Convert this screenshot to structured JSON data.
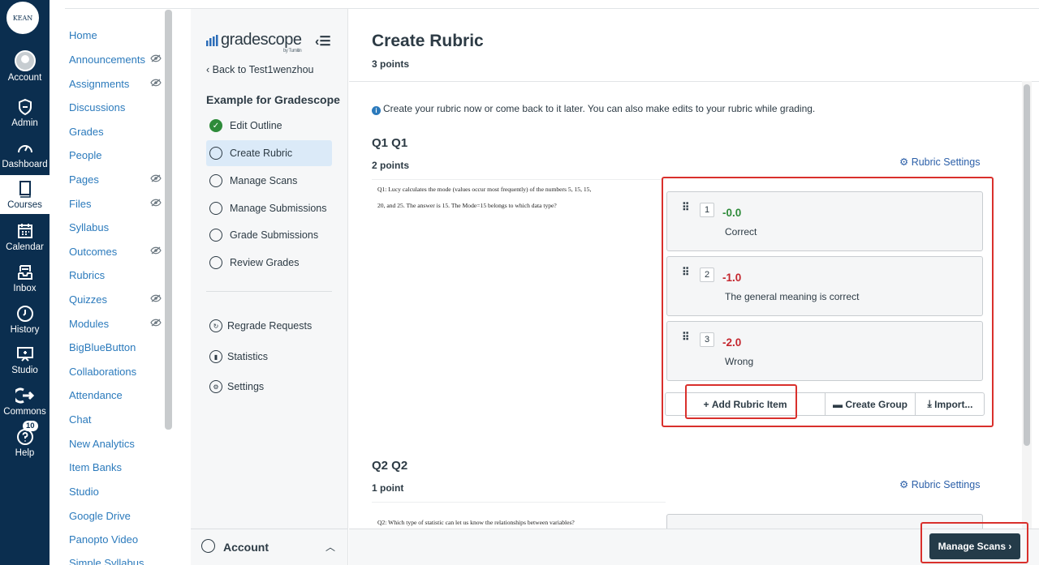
{
  "global_nav": {
    "items": [
      {
        "label": "Account",
        "icon": "account-avatar-icon"
      },
      {
        "label": "Admin",
        "icon": "shield-icon"
      },
      {
        "label": "Dashboard",
        "icon": "dashboard-gauge-icon"
      },
      {
        "label": "Courses",
        "icon": "book-icon"
      },
      {
        "label": "Calendar",
        "icon": "calendar-icon"
      },
      {
        "label": "Inbox",
        "icon": "inbox-icon"
      },
      {
        "label": "History",
        "icon": "clock-icon"
      },
      {
        "label": "Studio",
        "icon": "studio-icon"
      },
      {
        "label": "Commons",
        "icon": "commons-arrow-icon"
      },
      {
        "label": "Help",
        "icon": "help-icon",
        "badge": "10"
      }
    ]
  },
  "course_nav": {
    "links": [
      {
        "label": "Home",
        "hidden": false
      },
      {
        "label": "Announcements",
        "hidden": true
      },
      {
        "label": "Assignments",
        "hidden": true
      },
      {
        "label": "Discussions",
        "hidden": false
      },
      {
        "label": "Grades",
        "hidden": false
      },
      {
        "label": "People",
        "hidden": false
      },
      {
        "label": "Pages",
        "hidden": true
      },
      {
        "label": "Files",
        "hidden": true
      },
      {
        "label": "Syllabus",
        "hidden": false
      },
      {
        "label": "Outcomes",
        "hidden": true
      },
      {
        "label": "Rubrics",
        "hidden": false
      },
      {
        "label": "Quizzes",
        "hidden": true
      },
      {
        "label": "Modules",
        "hidden": true
      },
      {
        "label": "BigBlueButton",
        "hidden": false
      },
      {
        "label": "Collaborations",
        "hidden": false
      },
      {
        "label": "Attendance",
        "hidden": false
      },
      {
        "label": "Chat",
        "hidden": false
      },
      {
        "label": "New Analytics",
        "hidden": false
      },
      {
        "label": "Item Banks",
        "hidden": false
      },
      {
        "label": "Studio",
        "hidden": false
      },
      {
        "label": "Google Drive",
        "hidden": false
      },
      {
        "label": "Panopto Video",
        "hidden": false
      },
      {
        "label": "Simple Syllabus",
        "hidden": false
      }
    ]
  },
  "gradescope": {
    "logo_text": "gradescope",
    "logo_sub": "by Turnitin",
    "back_link": "Back to Test1wenzhou",
    "assignment_title": "Example for Gradescope",
    "steps": [
      {
        "label": "Edit Outline",
        "state": "done"
      },
      {
        "label": "Create Rubric",
        "state": "active"
      },
      {
        "label": "Manage Scans",
        "state": "todo"
      },
      {
        "label": "Manage Submissions",
        "state": "todo"
      },
      {
        "label": "Grade Submissions",
        "state": "todo"
      },
      {
        "label": "Review Grades",
        "state": "todo"
      }
    ],
    "tools": [
      {
        "label": "Regrade Requests",
        "icon": "regrade-icon"
      },
      {
        "label": "Statistics",
        "icon": "statistics-icon"
      },
      {
        "label": "Settings",
        "icon": "settings-gear-icon"
      }
    ],
    "account_label": "Account"
  },
  "main": {
    "title": "Create Rubric",
    "points": "3 points",
    "info": "Create your rubric now or come back to it later. You can also make edits to your rubric while grading.",
    "questions": [
      {
        "title": "Q1 Q1",
        "points": "2 points",
        "rubric_settings": "Rubric Settings",
        "text_line1": "Q1: Lucy calculates the mode (values occur most frequently) of the numbers 5, 15, 15,",
        "text_line2": "20, and 25. The answer is 15. The Mode=15 belongs to which data type?",
        "items": [
          {
            "num": "1",
            "points": "-0.0",
            "desc": "Correct",
            "color": "#2e8b3a"
          },
          {
            "num": "2",
            "points": "-1.0",
            "desc": "The general meaning is correct",
            "color": "#c4262e"
          },
          {
            "num": "3",
            "points": "-2.0",
            "desc": "Wrong",
            "color": "#c4262e"
          }
        ],
        "buttons": {
          "add": "Add Rubric Item",
          "group": "Create Group",
          "import": "Import..."
        }
      },
      {
        "title": "Q2 Q2",
        "points": "1 point",
        "rubric_settings": "Rubric Settings",
        "text_line1": "Q2: Which type of statistic can let us know the relationships between variables?"
      }
    ],
    "footer_button": "Manage Scans"
  }
}
